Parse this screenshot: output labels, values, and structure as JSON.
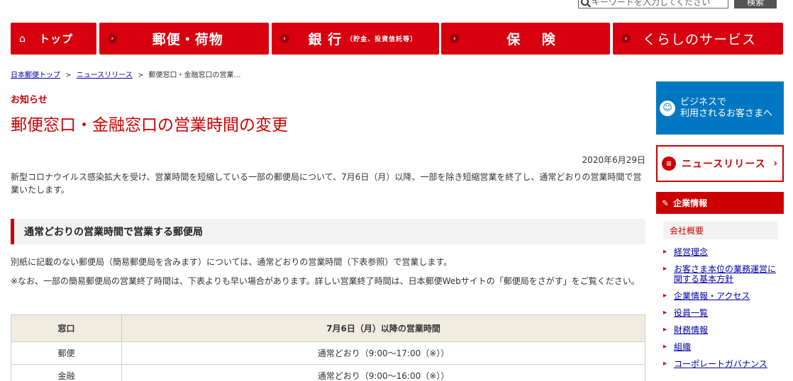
{
  "search": {
    "placeholder": "キーワードを入力してください",
    "button_label": "検索"
  },
  "gnav": {
    "home_label": "トップ",
    "items": [
      {
        "label": "郵便・荷物",
        "sub": ""
      },
      {
        "label": "銀 行",
        "sub": "（貯金、投資信託等）"
      },
      {
        "label": "保 険",
        "sub": ""
      },
      {
        "label": "くらしのサービス",
        "sub": ""
      }
    ]
  },
  "breadcrumb": {
    "items": [
      "日本郵便トップ",
      "ニュースリリース"
    ],
    "current": "郵便窓口・金融窓口の営業…",
    "separator": ">"
  },
  "main": {
    "eyebrow": "お知らせ",
    "title": "郵便窓口・金融窓口の営業時間の変更",
    "date": "2020年6月29日",
    "lead": "新型コロナウイルス感染拡大を受け、営業時間を短縮している一部の郵便局について、7月6日（月）以降、一部を除き短縮営業を終了し、通常どおりの営業時間で営業いたします。",
    "section_heading": "通常どおりの営業時間で営業する郵便局",
    "para1": "別紙に記載のない郵便局（簡易郵便局を含みます）については、通常どおりの営業時間（下表参照）で営業します。",
    "para2": "※なお、一部の簡易郵便局の営業終了時間は、下表よりも早い場合があります。詳しい営業終了時間は、日本郵便Webサイトの「郵便局をさがす」をご覧ください。",
    "table": {
      "headers": [
        "窓口",
        "7月6日（月）以降の営業時間"
      ],
      "rows": [
        [
          "郵便",
          "通常どおり（9:00〜17:00（※））"
        ],
        [
          "金融",
          "通常どおり（9:00〜16:00（※））"
        ]
      ]
    }
  },
  "sidebar": {
    "business_banner": "ビジネスで\n利用されるお客さまへ",
    "business_line1": "ビジネスで",
    "business_line2": "利用されるお客さまへ",
    "news_label": "ニュースリリース",
    "corp_heading": "企業情報",
    "subhead": "会社概要",
    "links": [
      "経営理念",
      "お客さま本位の業務運営に関する基本方針",
      "企業情報・アクセス",
      "役員一覧",
      "財務情報",
      "組織",
      "コーポレートガバナンス"
    ]
  },
  "colors": {
    "brand_red": "#d8000f",
    "business_blue": "#0077c2"
  }
}
